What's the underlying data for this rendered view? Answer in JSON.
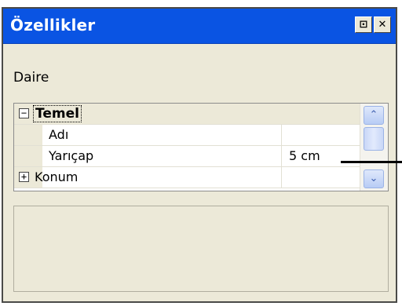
{
  "window": {
    "title": "Özellikler",
    "pin_button": "⊡",
    "close_button": "✕"
  },
  "object_name": "Daire",
  "property_grid": {
    "category": {
      "label": "Temel",
      "toggle": "−"
    },
    "rows": [
      {
        "label": "Adı",
        "value": ""
      },
      {
        "label": "Yarıçap",
        "value": "5 cm"
      },
      {
        "label": "Konum",
        "value": "",
        "toggle": "+"
      }
    ],
    "scroll": {
      "up_icon": "⌃",
      "down_icon": "⌄"
    }
  },
  "colors": {
    "title_bar": "#0a54e3",
    "panel": "#ece9d8",
    "scroll_button": "#b8ccf5"
  }
}
